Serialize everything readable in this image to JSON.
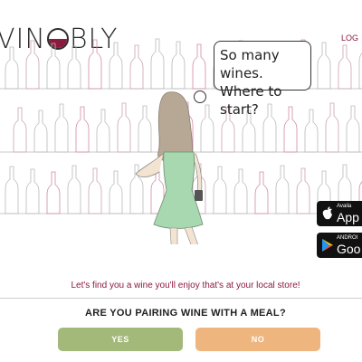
{
  "header": {
    "logo_text_start": "VIN",
    "logo_text_end": "BLY",
    "login_label": "LOG"
  },
  "scene": {
    "speech_line1": "So many wines.",
    "speech_line2": "Where to start?"
  },
  "badges": {
    "apple_small": "Availa",
    "apple_big": "App",
    "google_small": "ANDROI",
    "google_big": "Goo"
  },
  "main": {
    "tagline": "Let's find you a wine you'll enjoy that's at your local store!",
    "question": "ARE YOU PAIRING WINE WITH A MEAL?",
    "yes_label": "YES",
    "no_label": "NO"
  },
  "colors": {
    "brand": "#8b1a3d",
    "yes": "#a3b97a",
    "no": "#efb57e",
    "dress": "#a8d8b0"
  },
  "icons": {
    "apple": "apple-icon",
    "google_play": "google-play-icon"
  }
}
